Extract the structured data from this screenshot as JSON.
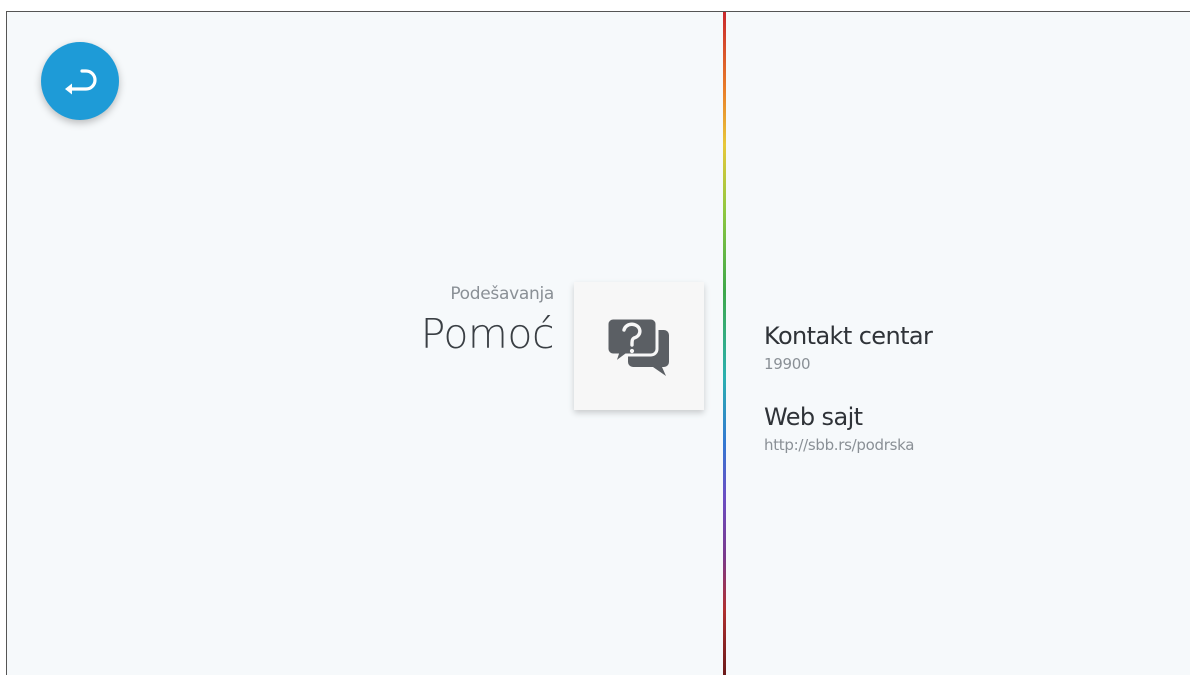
{
  "header": {
    "subtitle": "Podešavanja",
    "title": "Pomoć"
  },
  "icons": {
    "back": "back-arrow-icon",
    "help": "help-chat-icon"
  },
  "colors": {
    "accent": "#1e9bd7",
    "background": "#f6f9fb",
    "icon": "#5b5f64"
  },
  "info_items": [
    {
      "label": "Kontakt centar",
      "value": "19900"
    },
    {
      "label": "Web sajt",
      "value": "http://sbb.rs/podrska"
    }
  ]
}
